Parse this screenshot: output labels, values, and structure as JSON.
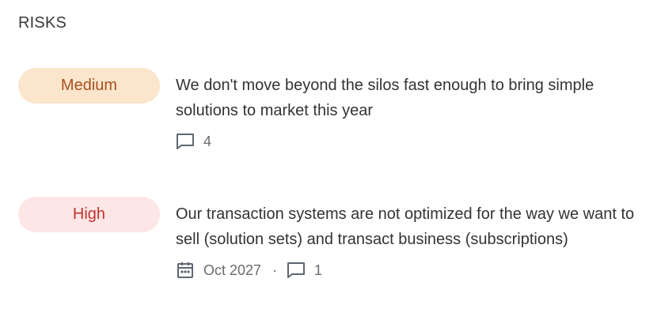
{
  "section": {
    "title": "RISKS"
  },
  "risks": [
    {
      "level": "Medium",
      "text": "We don't move beyond the silos fast enough to bring simple solutions to market this year",
      "comment_count": "4"
    },
    {
      "level": "High",
      "text": "Our transaction systems are not optimized for the way we want to sell (solution sets) and transact business (subscriptions)",
      "date": "Oct 2027",
      "separator": "·",
      "comment_count": "1"
    }
  ],
  "colors": {
    "medium_bg": "#fbe5cc",
    "medium_text": "#a7521f",
    "high_bg": "#fde6e6",
    "high_text": "#c1342f"
  },
  "icons": {
    "comment": "comment-icon",
    "calendar": "calendar-icon"
  }
}
